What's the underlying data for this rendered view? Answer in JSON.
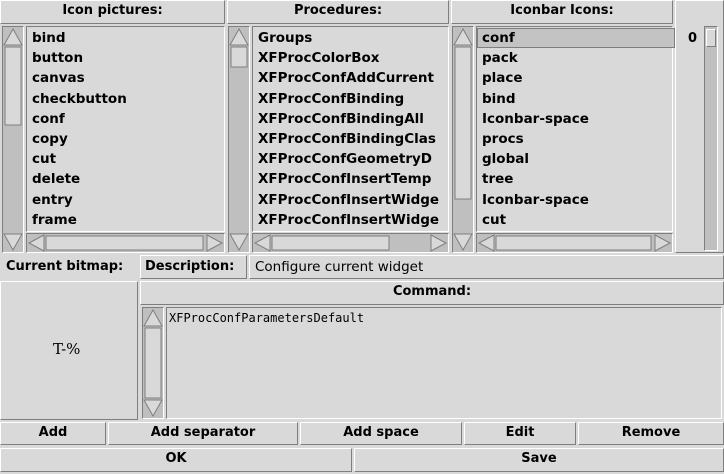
{
  "icon_pictures": {
    "header": "Icon pictures:",
    "items": [
      "bind",
      "button",
      "canvas",
      "checkbutton",
      "conf",
      "copy",
      "cut",
      "delete",
      "entry",
      "frame"
    ]
  },
  "procedures": {
    "header": "Procedures:",
    "items": [
      "Groups",
      "XFProcColorBox",
      "XFProcConfAddCurrent",
      "XFProcConfBinding",
      "XFProcConfBindingAll",
      "XFProcConfBindingClas",
      "XFProcConfGeometryD",
      "XFProcConfInsertTemp",
      "XFProcConfInsertWidge",
      "XFProcConfInsertWidge"
    ]
  },
  "iconbar_icons": {
    "header": "Iconbar Icons:",
    "items": [
      "conf",
      "pack",
      "place",
      "bind",
      "Iconbar-space",
      "procs",
      "global",
      "tree",
      "Iconbar-space",
      "cut"
    ],
    "selected_index": 0
  },
  "scale": {
    "value": "0"
  },
  "current_bitmap": {
    "label": "Current bitmap:",
    "preview_text": "T-%"
  },
  "description": {
    "label": "Description:",
    "value": "Configure current widget"
  },
  "command": {
    "header": "Command:",
    "value": "XFProcConfParametersDefault"
  },
  "buttons": {
    "add": "Add",
    "add_separator": "Add separator",
    "add_space": "Add space",
    "edit": "Edit",
    "remove": "Remove",
    "ok": "OK",
    "save": "Save"
  },
  "colors": {
    "background": "#d9d9d9",
    "trough": "#bfbfbf",
    "selection": "#c3c3c3"
  }
}
